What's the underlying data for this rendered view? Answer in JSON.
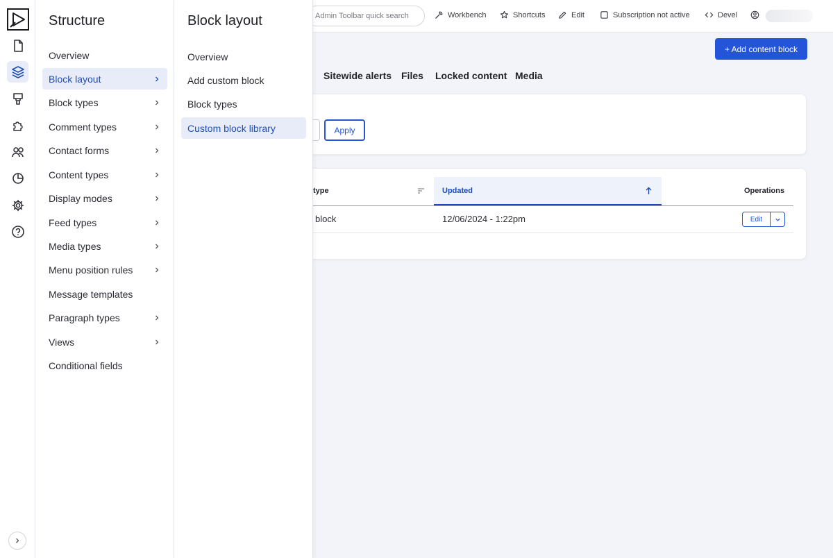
{
  "rail": {
    "icons": [
      "logo-icon",
      "file-icon",
      "layers-icon",
      "brush-icon",
      "puzzle-icon",
      "users-icon",
      "chart-pie-icon",
      "gear-icon",
      "help-icon"
    ],
    "active": "layers-icon"
  },
  "structure": {
    "title": "Structure",
    "items": [
      {
        "label": "Overview",
        "chevron": false
      },
      {
        "label": "Block layout",
        "chevron": true,
        "active": true
      },
      {
        "label": "Block types",
        "chevron": true
      },
      {
        "label": "Comment types",
        "chevron": true
      },
      {
        "label": "Contact forms",
        "chevron": true
      },
      {
        "label": "Content types",
        "chevron": true
      },
      {
        "label": "Display modes",
        "chevron": true
      },
      {
        "label": "Feed types",
        "chevron": true
      },
      {
        "label": "Media types",
        "chevron": true
      },
      {
        "label": "Menu position rules",
        "chevron": true
      },
      {
        "label": "Message templates",
        "chevron": false
      },
      {
        "label": "Paragraph types",
        "chevron": true
      },
      {
        "label": "Views",
        "chevron": true
      },
      {
        "label": "Conditional fields",
        "chevron": false
      }
    ]
  },
  "block_layout": {
    "title": "Block layout",
    "items": [
      {
        "label": "Overview"
      },
      {
        "label": "Add custom block"
      },
      {
        "label": "Block types"
      },
      {
        "label": "Custom block library",
        "active": true
      }
    ]
  },
  "toolbar": {
    "search_placeholder": "Admin Toolbar quick search",
    "workbench": "Workbench",
    "shortcuts": "Shortcuts",
    "edit": "Edit",
    "subscription": "Subscription not active",
    "devel": "Devel"
  },
  "actions": {
    "add_content_block": "+ Add content block"
  },
  "tabs": [
    "Sitewide alerts",
    "Files",
    "Locked content",
    "Media"
  ],
  "filter": {
    "apply": "Apply"
  },
  "table": {
    "headers": {
      "type": "type",
      "updated": "Updated",
      "operations": "Operations"
    },
    "rows": [
      {
        "type": "block",
        "updated": "12/06/2024 - 1:22pm",
        "edit": "Edit"
      }
    ]
  },
  "colors": {
    "primary": "#2455d8",
    "active_bg": "#e7ecf8",
    "active_text": "#1f4fb4"
  }
}
